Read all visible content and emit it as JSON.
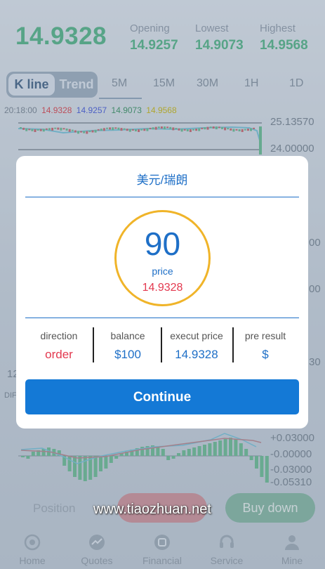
{
  "header": {
    "current_price": "14.9328",
    "stats": [
      {
        "label": "Opening",
        "value": "14.9257"
      },
      {
        "label": "Lowest",
        "value": "14.9073"
      },
      {
        "label": "Highest",
        "value": "14.9568"
      }
    ]
  },
  "view_toggle": {
    "kline_label": "K line",
    "trend_label": "Trend"
  },
  "timeframes": [
    "5M",
    "15M",
    "30M",
    "1H",
    "1D"
  ],
  "ohlc_legend": {
    "time": "20:18:00",
    "values": [
      "14.9328",
      "14.9257",
      "14.9073",
      "14.9568"
    ],
    "colors": [
      "#d9363e",
      "#3b4fd6",
      "#2e8b57",
      "#c8b400"
    ]
  },
  "axis_labels": {
    "price_top": "25.13570",
    "price_second": "24.00000",
    "partial_a": "00",
    "partial_b": "00",
    "partial_c": "30",
    "left_partial": "12",
    "dif_partial": "DIF",
    "macd_top": "+0.03000",
    "macd_mid": "-0.00000",
    "macd_low": "-0.03000",
    "macd_bottom": "-0.05310"
  },
  "modal": {
    "title": "美元/瑞朗",
    "countdown": "90",
    "price_label": "price",
    "price_value": "14.9328",
    "columns": [
      {
        "header": "direction",
        "value": "order",
        "color": "#e3394f"
      },
      {
        "header": "balance",
        "value": "$100",
        "color": "#1e6fc7"
      },
      {
        "header": "execut price",
        "value": "14.9328",
        "color": "#1e6fc7"
      },
      {
        "header": "pre result",
        "value": "$",
        "color": "#1e6fc7"
      }
    ],
    "continue_label": "Continue"
  },
  "bottom": {
    "position_label": "Position",
    "buy_down_label": "Buy down",
    "watermark": "www.tiaozhuan.net"
  },
  "nav": [
    {
      "label": "Home",
      "icon": "home-icon"
    },
    {
      "label": "Quotes",
      "icon": "quotes-icon"
    },
    {
      "label": "Financial",
      "icon": "financial-icon"
    },
    {
      "label": "Service",
      "icon": "service-icon"
    },
    {
      "label": "Mine",
      "icon": "mine-icon"
    }
  ]
}
